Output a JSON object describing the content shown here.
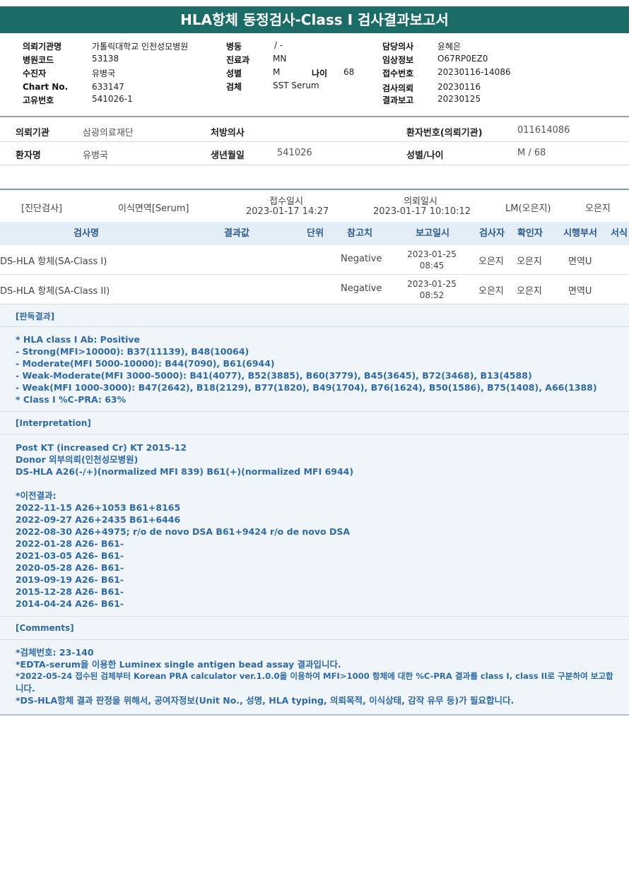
{
  "title": "HLA항체 동정검사-Class I 검사결과보고서",
  "top_info": {
    "institution_label": "의뢰기관명",
    "institution": "가톨릭대학교 인천성모병원",
    "hospital_code_label": "병원코드",
    "hospital_code": "53138",
    "recipient_label": "수진자",
    "recipient": "유병국",
    "chart_label": "Chart No.",
    "chart_no": "633147",
    "unique_label": "고유번호",
    "unique_no": "541026-1",
    "ward_label": "병동",
    "ward": "/ -",
    "dept_label": "진료과",
    "dept": "MN",
    "sex_label": "성별",
    "sex": "M",
    "age_label": "나이",
    "age": "68",
    "specimen_label": "검체",
    "specimen": "SST Serum",
    "doctor_label": "담당의사",
    "doctor": "윤혜은",
    "clinical_label": "임상정보",
    "clinical": "O67RP0EZ0",
    "receipt_label": "접수번호",
    "receipt": "20230116-14086",
    "request_label": "검사의뢰",
    "request": "20230116",
    "report_label": "결과보고",
    "report": "20230125"
  },
  "patient_info": {
    "inst_label": "의뢰기관",
    "inst": "삼광의료재단",
    "prescriber_label": "처방의사",
    "prescriber": "",
    "patient_no_label": "환자번호(의뢰기관)",
    "patient_no": "011614086",
    "name_label": "환자명",
    "name": "유병국",
    "dob_label": "생년월일",
    "dob": "541026",
    "sexage_label": "성별/나이",
    "sexage": "M / 68"
  },
  "specimen_row": {
    "category": "[진단검사]",
    "type": "이식면역[Serum]",
    "received_label": "접수일시",
    "received": "2023-01-17 14:27",
    "requested_label": "의뢰일시",
    "requested": "2023-01-17 10:10:12",
    "lm": "LM(오은지)",
    "tester": "오은지"
  },
  "table": {
    "headers": [
      "검사명",
      "결과값",
      "단위",
      "참고치",
      "보고일시",
      "검사자",
      "확인자",
      "시행부서",
      "서식"
    ],
    "rows": [
      {
        "name": "DS-HLA 항체(SA-Class I)",
        "result": "",
        "unit": "",
        "ref": "Negative",
        "date": "2023-01-25",
        "time": "08:45",
        "tester": "오은지",
        "confirmer": "오은지",
        "dept": "면역U"
      },
      {
        "name": "DS-HLA 항체(SA-Class II)",
        "result": "",
        "unit": "",
        "ref": "Negative",
        "date": "2023-01-25",
        "time": "08:52",
        "tester": "오은지",
        "confirmer": "오은지",
        "dept": "면역U"
      }
    ]
  },
  "sections": {
    "judgment_head": "[판독결과]",
    "judgment_lines": [
      "* HLA class I Ab: Positive",
      "- Strong(MFI>10000): B37(11139), B48(10064)",
      "- Moderate(MFI 5000-10000): B44(7090), B61(6944)",
      "- Weak-Moderate(MFI 3000-5000): B41(4077), B52(3885), B60(3779), B45(3645), B72(3468), B13(4588)",
      "- Weak(MFI 1000-3000): B47(2642), B18(2129), B77(1820), B49(1704), B76(1624), B50(1586), B75(1408), A66(1388)",
      "* Class I %C-PRA: 63%"
    ],
    "interp_head": "[Interpretation]",
    "interp_lines": [
      "Post KT (increased Cr) KT 2015-12",
      "Donor 외부의뢰(인천성모병원)",
      "DS-HLA A26(-/+)(normalized MFI 839) B61(+)(normalized MFI 6944)",
      "",
      "*이전결과:",
      "2022-11-15 A26+1053 B61+8165",
      "2022-09-27 A26+2435 B61+6446",
      "2022-08-30 A26+4975; r/o de novo DSA B61+9424 r/o de novo DSA",
      "2022-01-28 A26- B61-",
      "2021-03-05 A26- B61-",
      "2020-05-28 A26- B61-",
      "2019-09-19 A26- B61-",
      "2015-12-28 A26- B61-",
      "2014-04-24 A26- B61-"
    ],
    "comments_head": "[Comments]",
    "comments_lines": [
      "*검체번호: 23-140",
      "*EDTA-serum을 이용한 Luminex single antigen bead assay 결과입니다.",
      "*2022-05-24 접수된 검체부터 Korean PRA calculator ver.1.0.0을 이용하여 MFI>1000 항체에 대한 %C-PRA 결과를 class I, class II로 구분하여 보고합",
      "니다.",
      "*DS-HLA항체 결과 판정을 위해서, 공여자정보(Unit No., 성명, HLA typing, 의뢰목적, 이식상태, 감작 유무 등)가 필요합니다."
    ]
  }
}
